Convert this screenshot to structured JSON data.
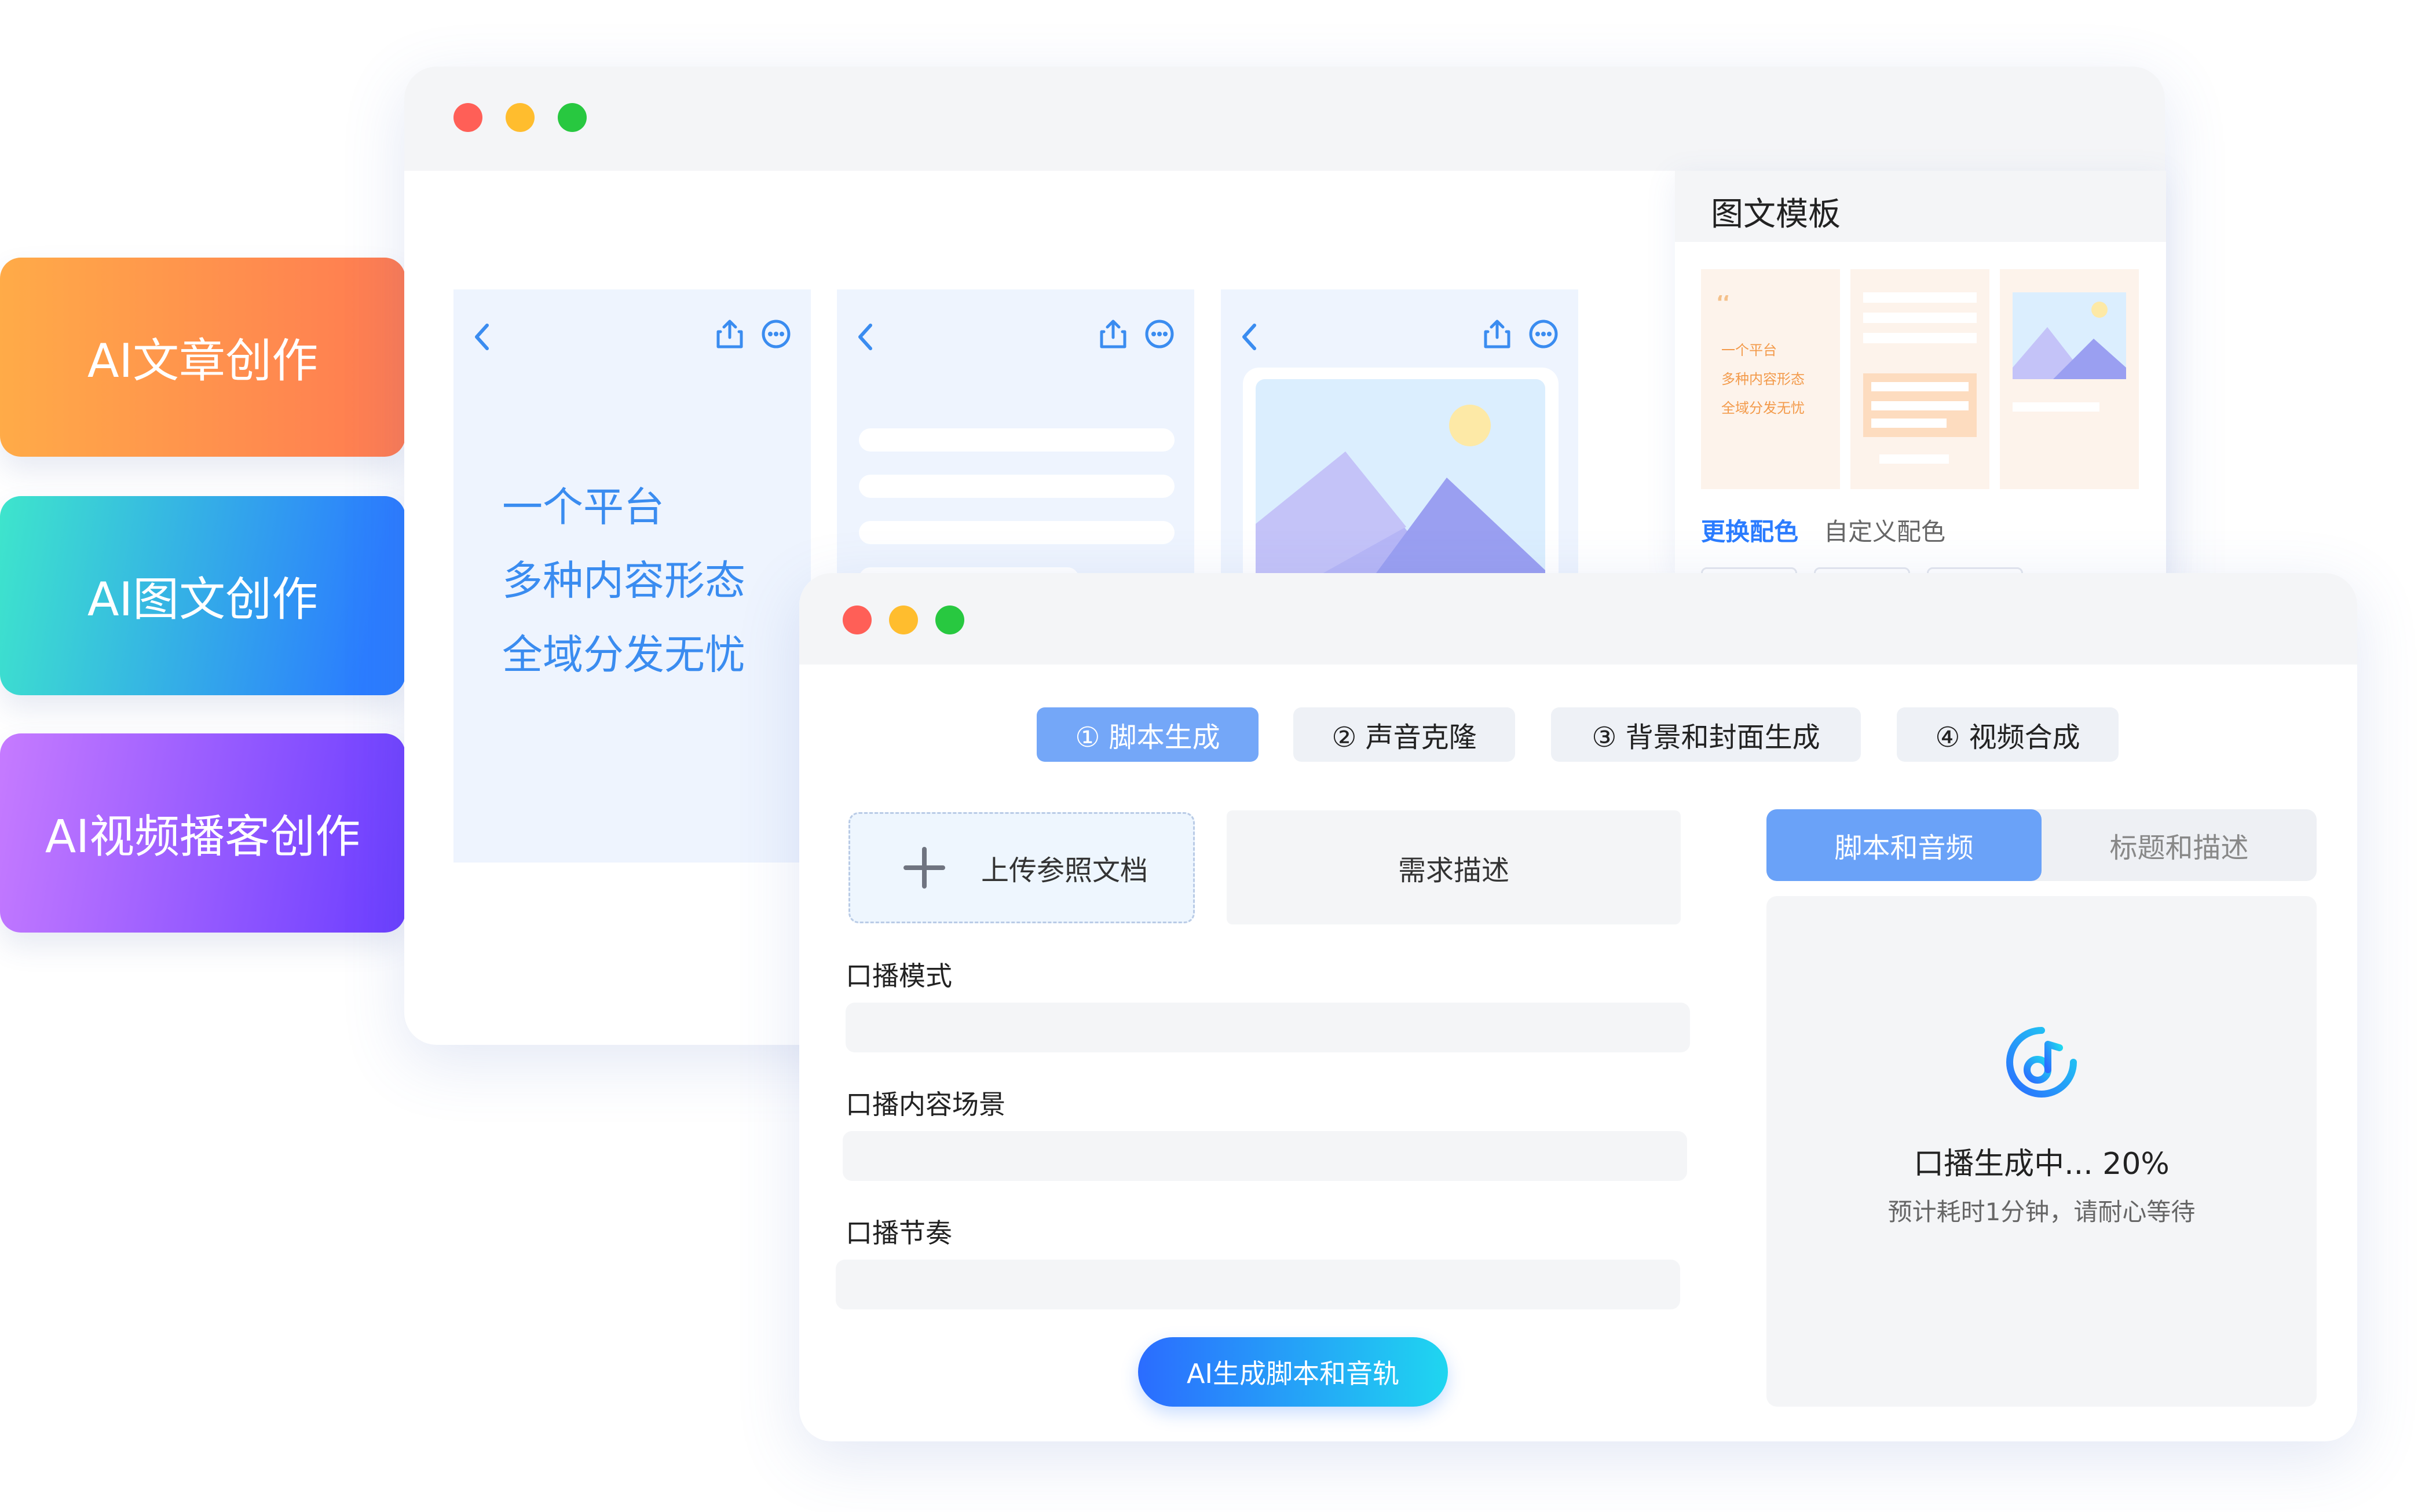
{
  "side_cards": [
    {
      "label": "AI文章创作",
      "gradient_from": "#ffab48",
      "gradient_to": "#ff7a52"
    },
    {
      "label": "AI图文创作",
      "gradient_from": "#3ee5cc",
      "gradient_to": "#2b7cff"
    },
    {
      "label": "AI视频播客创作",
      "gradient_from": "#c67bff",
      "gradient_to": "#6a3dff"
    }
  ],
  "back_window": {
    "traffic_lights": [
      "#ff5f57",
      "#ffbd2e",
      "#28c840"
    ],
    "slogan": [
      "一个平台",
      "多种内容形态",
      "全域分发无忧"
    ],
    "slogan_color": "#3a8cf0",
    "phone_icons": [
      "back-icon",
      "share-icon",
      "more-icon"
    ]
  },
  "template_panel": {
    "title": "图文模板",
    "preview_text": [
      "一个平台",
      "多种内容形态",
      "全域分发无忧"
    ],
    "links": {
      "change_colors": "更换配色",
      "custom_colors": "自定义配色"
    },
    "accent": "#2b7cff"
  },
  "front_window": {
    "steps": [
      {
        "label": "① 脚本生成",
        "active": true
      },
      {
        "label": "② 声音克隆",
        "active": false
      },
      {
        "label": "③ 背景和封面生成",
        "active": false
      },
      {
        "label": "④ 视频合成",
        "active": false
      }
    ],
    "upload_label": "上传参照文档",
    "requirement_label": "需求描述",
    "fields": [
      {
        "label": "口播模式",
        "value": ""
      },
      {
        "label": "口播内容场景",
        "value": ""
      },
      {
        "label": "口播节奏",
        "value": ""
      }
    ],
    "generate_button": "AI生成脚本和音轨",
    "right_tabs": [
      {
        "label": "脚本和音频",
        "active": true
      },
      {
        "label": "标题和描述",
        "active": false
      }
    ],
    "progress": {
      "status": "口播生成中... 20%",
      "percent": 20,
      "hint": "预计耗时1分钟，请耐心等待",
      "icon": "music-note-icon"
    }
  }
}
